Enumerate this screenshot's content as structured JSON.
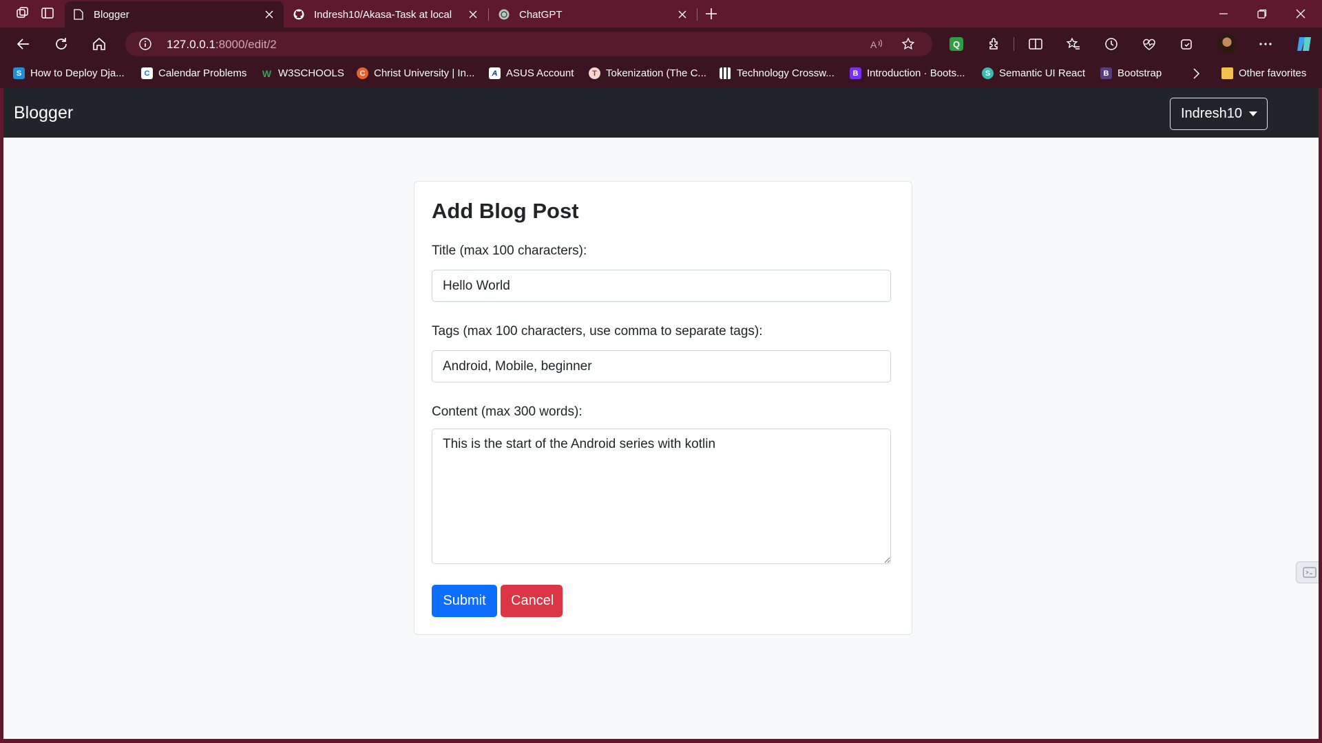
{
  "browser": {
    "tabs": [
      {
        "title": "Blogger",
        "active": true
      },
      {
        "title": "Indresh10/Akasa-Task at local",
        "active": false
      },
      {
        "title": "ChatGPT",
        "active": false
      }
    ],
    "address": {
      "host": "127.0.0.1",
      "path": ":8000/edit/2"
    },
    "bookmarks": [
      {
        "label": "How to Deploy Dja...",
        "icon": "s-icon"
      },
      {
        "label": "Calendar Problems",
        "icon": "calendar-icon"
      },
      {
        "label": "W3SCHOOLS",
        "icon": "w3schools-icon"
      },
      {
        "label": "Christ University | In...",
        "icon": "university-icon"
      },
      {
        "label": "ASUS Account",
        "icon": "asus-icon"
      },
      {
        "label": "Tokenization (The C...",
        "icon": "tokenization-icon"
      },
      {
        "label": "Technology Crossw...",
        "icon": "crossword-icon"
      },
      {
        "label": "Introduction · Boots...",
        "icon": "bootstrap-icon"
      },
      {
        "label": "Semantic UI React",
        "icon": "semantic-ui-icon"
      },
      {
        "label": "Bootstrap",
        "icon": "bootstrap-icon"
      }
    ],
    "other_favorites": "Other favorites"
  },
  "navbar": {
    "brand": "Blogger",
    "user": "Indresh10"
  },
  "form": {
    "heading": "Add Blog Post",
    "title_label": "Title (max 100 characters):",
    "title_value": "Hello World",
    "tags_label": "Tags (max 100 characters, use comma to separate tags):",
    "tags_value": "Android, Mobile, beginner",
    "content_label": "Content (max 300 words):",
    "content_value": "This is the start of the Android series with kotlin",
    "submit_label": "Submit",
    "cancel_label": "Cancel"
  },
  "colors": {
    "chrome": "#5e1a2c",
    "toolbar": "#3a1420",
    "navbar": "#212529",
    "primary": "#0d6efd",
    "danger": "#dc3545"
  }
}
